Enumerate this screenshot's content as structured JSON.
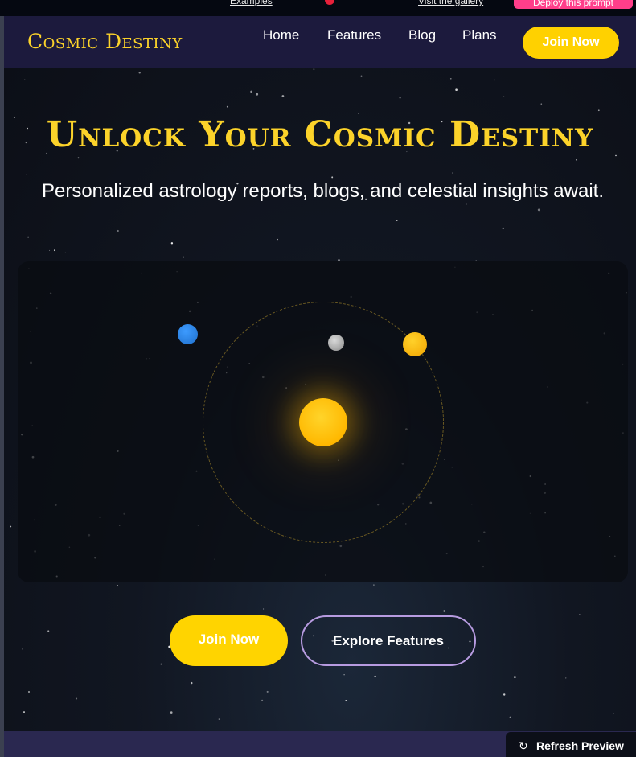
{
  "top_strip": {
    "link_1": "Examples",
    "link_2": "Visit the gallery",
    "button": "Deploy this prompt"
  },
  "nav": {
    "brand": "Cosmic Destiny",
    "items": [
      "Home",
      "Features",
      "Blog",
      "Plans"
    ],
    "cta": "Join Now"
  },
  "hero": {
    "title": "Unlock Your Cosmic Destiny",
    "subtitle": "Personalized astrology reports, blogs, and celestial insights await.",
    "primary_cta": "Join Now",
    "secondary_cta": "Explore Features"
  },
  "preview": {
    "refresh_label": "Refresh Preview",
    "refresh_icon": "refresh-icon"
  },
  "colors": {
    "brand_gold": "#fcd32a",
    "button_yellow": "#ffd400",
    "nav_bg": "#1c1a3d",
    "outline_purple": "#b79be0",
    "strip_pink": "#ff3e8a"
  }
}
